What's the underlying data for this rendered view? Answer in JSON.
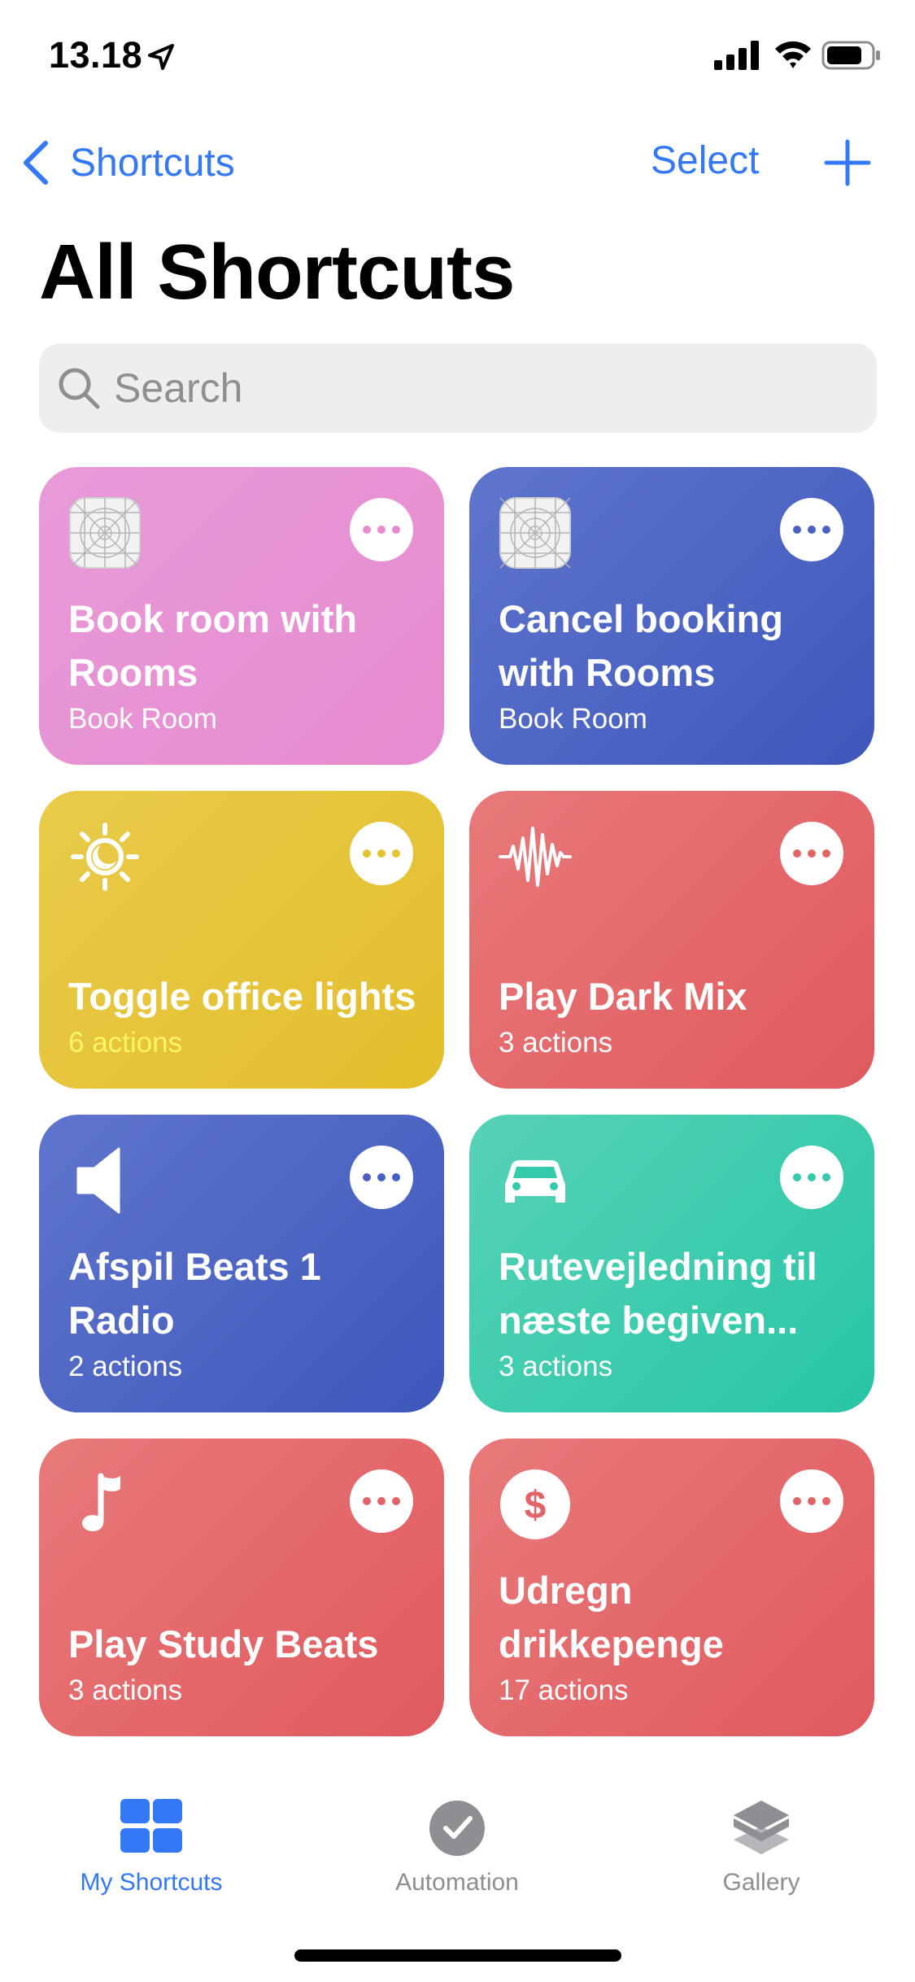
{
  "status_bar": {
    "time": "13.18"
  },
  "nav": {
    "back_label": "Shortcuts",
    "select_label": "Select"
  },
  "page_title": "All Shortcuts",
  "search": {
    "placeholder": "Search",
    "value": ""
  },
  "tiles": [
    {
      "title": "Book room with Rooms",
      "subtitle": "Book Room",
      "icon": "app-placeholder-icon",
      "color": "#e68bcf"
    },
    {
      "title": "Cancel booking with Rooms",
      "subtitle": "Book Room",
      "icon": "app-placeholder-icon",
      "color": "#4a60c2"
    },
    {
      "title": "Toggle office lights",
      "subtitle": "6 actions",
      "icon": "sun-moon-icon",
      "color": "#e5c233"
    },
    {
      "title": "Play Dark Mix",
      "subtitle": "3 actions",
      "icon": "waveform-icon",
      "color": "#e36468"
    },
    {
      "title": "Afspil Beats 1 Radio",
      "subtitle": "2 actions",
      "icon": "speaker-icon",
      "color": "#4a60c2"
    },
    {
      "title": "Rutevejledning til næste begiven...",
      "subtitle": "3 actions",
      "icon": "car-icon",
      "color": "#35caab"
    },
    {
      "title": "Play Study Beats",
      "subtitle": "3 actions",
      "icon": "music-note-icon",
      "color": "#e36468"
    },
    {
      "title": "Udregn drikkepenge",
      "subtitle": "17 actions",
      "icon": "dollar-icon",
      "color": "#e36468"
    }
  ],
  "tab_bar": [
    {
      "label": "My Shortcuts",
      "icon": "grid-icon",
      "active": true
    },
    {
      "label": "Automation",
      "icon": "checkmark-clock-icon",
      "active": false
    },
    {
      "label": "Gallery",
      "icon": "layers-icon",
      "active": false
    }
  ],
  "colors": {
    "accent": "#3478f6",
    "inactive_tab": "#8e8e93"
  }
}
